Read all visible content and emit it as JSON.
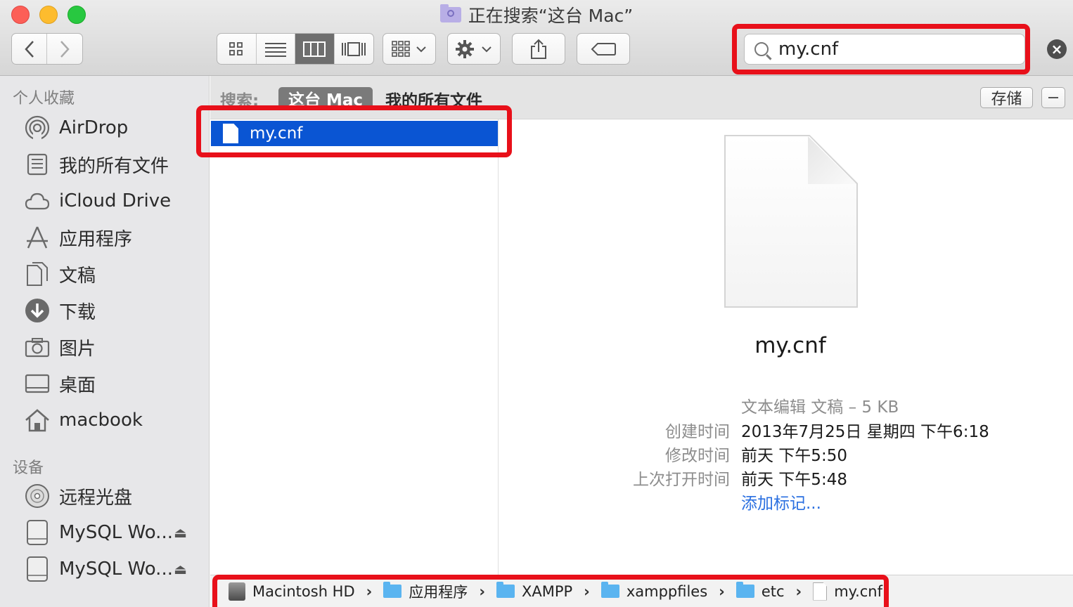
{
  "window": {
    "title": "正在搜索“这台 Mac”"
  },
  "toolbar": {
    "back_label": "‹",
    "forward_label": "›",
    "search": {
      "value": "my.cnf"
    }
  },
  "scope": {
    "label": "搜索:",
    "active": "这台 Mac",
    "other": "我的所有文件",
    "save_label": "存储"
  },
  "sidebar": {
    "favorites_header": "个人收藏",
    "favorites": [
      {
        "label": "AirDrop",
        "icon": "airdrop-icon"
      },
      {
        "label": "我的所有文件",
        "icon": "all-files-icon"
      },
      {
        "label": "iCloud Drive",
        "icon": "cloud-icon"
      },
      {
        "label": "应用程序",
        "icon": "applications-icon"
      },
      {
        "label": "文稿",
        "icon": "documents-icon"
      },
      {
        "label": "下载",
        "icon": "downloads-icon"
      },
      {
        "label": "图片",
        "icon": "camera-icon"
      },
      {
        "label": "桌面",
        "icon": "desktop-icon"
      },
      {
        "label": "macbook",
        "icon": "home-icon"
      }
    ],
    "devices_header": "设备",
    "devices": [
      {
        "label": "远程光盘",
        "icon": "disc-icon"
      },
      {
        "label": "MySQL Wo...",
        "icon": "drive-icon"
      },
      {
        "label": "MySQL Wo...",
        "icon": "drive-icon"
      }
    ]
  },
  "results": [
    {
      "name": "my.cnf",
      "selected": true
    }
  ],
  "preview": {
    "name": "my.cnf",
    "kind": "文本编辑 文稿 – 5 KB",
    "created_label": "创建时间",
    "created_value": "2013年7月25日 星期四 下午6:18",
    "modified_label": "修改时间",
    "modified_value": "前天 下午5:50",
    "opened_label": "上次打开时间",
    "opened_value": "前天 下午5:48",
    "add_tags": "添加标记..."
  },
  "pathbar": [
    "Macintosh HD",
    "应用程序",
    "XAMPP",
    "xamppfiles",
    "etc",
    "my.cnf"
  ],
  "colors": {
    "highlight": "#e8101a",
    "selection": "#0a55d3",
    "link": "#2a6fe0"
  }
}
